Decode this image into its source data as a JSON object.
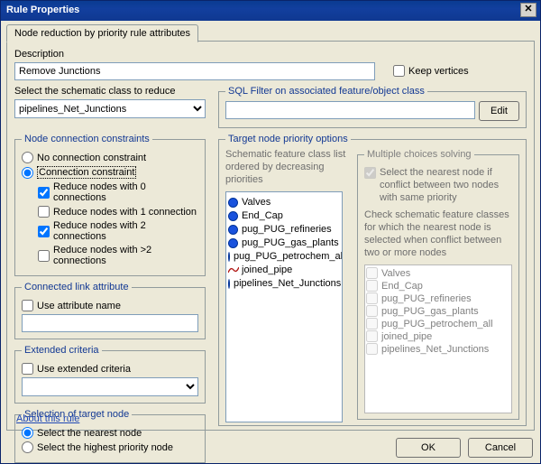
{
  "title": "Rule Properties",
  "tab": "Node reduction by priority rule attributes",
  "description": {
    "label": "Description",
    "value": "Remove Junctions"
  },
  "keep_vertices": {
    "label": "Keep vertices",
    "checked": false
  },
  "class_select": {
    "label": "Select the schematic class to reduce",
    "value": "pipelines_Net_Junctions"
  },
  "sql_filter": {
    "legend": "SQL Filter on associated feature/object class",
    "value": "",
    "edit_label": "Edit"
  },
  "node_conn": {
    "legend": "Node connection constraints",
    "no_constraint": "No connection constraint",
    "constraint": "Connection constraint",
    "selected": "constraint",
    "opt0": {
      "label": "Reduce nodes with 0 connections",
      "checked": true
    },
    "opt1": {
      "label": "Reduce nodes with 1 connection",
      "checked": false
    },
    "opt2": {
      "label": "Reduce nodes with 2 connections",
      "checked": true
    },
    "opt3": {
      "label": "Reduce nodes with >2 connections",
      "checked": false
    }
  },
  "linkattr": {
    "legend": "Connected link attribute",
    "use_label": "Use attribute name",
    "use_checked": false,
    "value": ""
  },
  "ext": {
    "legend": "Extended criteria",
    "use_label": "Use extended criteria",
    "use_checked": false,
    "value": ""
  },
  "target_select": {
    "legend": "Selection of target node",
    "nearest": "Select the nearest node",
    "highest": "Select the highest priority node",
    "selected": "nearest"
  },
  "priority": {
    "legend": "Target node priority options",
    "help": "Schematic feature class list ordered by decreasing priorities",
    "items": [
      {
        "name": "Valves",
        "icon": "bullet"
      },
      {
        "name": "End_Cap",
        "icon": "bullet"
      },
      {
        "name": "pug_PUG_refineries",
        "icon": "bullet"
      },
      {
        "name": "pug_PUG_gas_plants",
        "icon": "bullet"
      },
      {
        "name": "pug_PUG_petrochem_all",
        "icon": "bullet"
      },
      {
        "name": "joined_pipe",
        "icon": "line"
      },
      {
        "name": "pipelines_Net_Junctions",
        "icon": "bullet"
      }
    ]
  },
  "multi": {
    "legend": "Multiple choices solving",
    "opt_label": "Select the nearest node if conflict between two nodes with same priority",
    "opt_checked": true,
    "help": "Check schematic feature classes for which the nearest node is selected when conflict between two or more nodes",
    "items": [
      "Valves",
      "End_Cap",
      "pug_PUG_refineries",
      "pug_PUG_gas_plants",
      "pug_PUG_petrochem_all",
      "joined_pipe",
      "pipelines_Net_Junctions"
    ]
  },
  "about": "About this rule",
  "ok": "OK",
  "cancel": "Cancel"
}
